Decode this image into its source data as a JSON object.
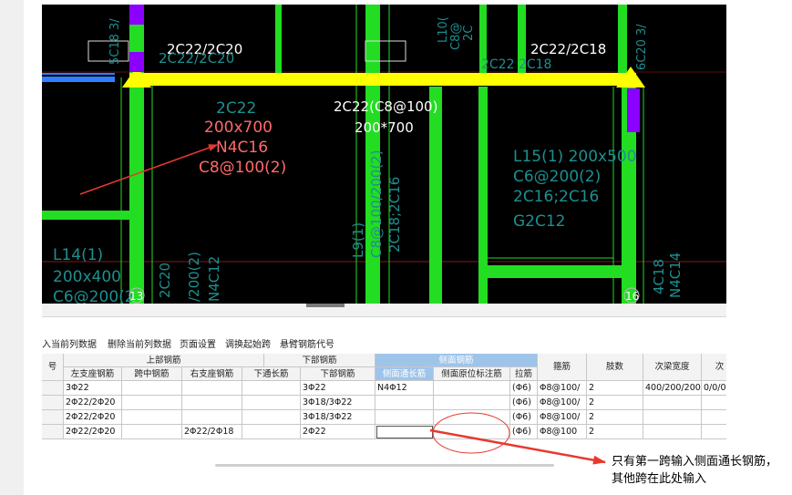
{
  "cad": {
    "label_top_left": "2C22/2C20",
    "label_top_right": "2C22/2C18",
    "ghost_top_left": "2C22/2C20",
    "ghost_top_right": "2C22 2C18",
    "vert_top_1": "5C18 3/",
    "vert_top_2": "L10(",
    "vert_top_3": "C8@",
    "vert_top_4": "2C",
    "vert_top_5": "6C20 3/",
    "beam_name": "2C22(C8@100)",
    "beam_size": "200*700",
    "left_label": "2C22",
    "red_size": "200x700",
    "red_side": "N4C16",
    "red_stirrup": "C8@100(2)",
    "l15_1": "L15(1) 200x500",
    "l15_2": "C6@200(2)",
    "l15_3": "2C16;2C16",
    "l15_4": "G2C12",
    "l14_1": "L14(1)",
    "l14_2": "200x400",
    "l14_3": "C6@200(2",
    "l9_1": "L9(1)",
    "l9_2": "C8@100/200(2)",
    "l9_3": "2C18;2C16",
    "l9_4": "200x400",
    "v_bot_1": "2C20",
    "v_bot_2": "/200(2)",
    "v_bot_3": "N4C12",
    "v_bot_4": "4C18",
    "v_bot_5": "N4C14",
    "col_num_left": "13",
    "col_num_right": "16"
  },
  "toolbar": {
    "insert": "入当前列数据",
    "delete": "删除当前列数据",
    "page_setup": "页面设置",
    "swap_start": "调换起始跨",
    "cantilever": "悬臂钢筋代号"
  },
  "grid": {
    "headers": {
      "num": "号",
      "top": "上部钢筋",
      "bottom": "下部钢筋",
      "side": "侧面钢筋",
      "left_support": "左支座钢筋",
      "mid_span": "跨中钢筋",
      "right_support": "右支座钢筋",
      "bottom_through": "下通长筋",
      "bottom_bar": "下部钢筋",
      "side_through": "侧面通长筋",
      "side_original": "侧面原位标注筋",
      "tie": "拉筋",
      "stirrup": "箍筋",
      "legs": "肢数",
      "sub_width": "次梁宽度",
      "sub_extra": "次"
    },
    "rows": [
      {
        "left": "3Φ22",
        "mid": "",
        "right": "",
        "bthru": "",
        "bottom": "3Φ22",
        "side": "N4Φ12",
        "orig": "",
        "tie": "(Φ6)",
        "stirrup": "Φ8@100/",
        "legs": "2",
        "subw": "400/200/200",
        "extra": "0/0/0"
      },
      {
        "left": "2Φ22/2Φ20",
        "mid": "",
        "right": "",
        "bthru": "",
        "bottom": "3Φ18/3Φ22",
        "side": "",
        "orig": "",
        "tie": "(Φ6)",
        "stirrup": "Φ8@100/",
        "legs": "2",
        "subw": "",
        "extra": ""
      },
      {
        "left": "2Φ22/2Φ20",
        "mid": "",
        "right": "",
        "bthru": "",
        "bottom": "3Φ18/3Φ22",
        "side": "",
        "orig": "",
        "tie": "(Φ6)",
        "stirrup": "Φ8@100/",
        "legs": "2",
        "subw": "",
        "extra": ""
      },
      {
        "left": "2Φ22/2Φ20",
        "mid": "",
        "right": "2Φ22/2Φ18",
        "bthru": "",
        "bottom": "2Φ22",
        "side": "",
        "orig": "",
        "tie": "(Φ6)",
        "stirrup": "Φ8@100",
        "legs": "2",
        "subw": "",
        "extra": ""
      }
    ]
  },
  "annotation": {
    "note": "只有第一跨输入侧面通长钢筋，其他跨在此处输入"
  },
  "colors": {
    "cad_bg": "#000000",
    "beam_green": "#22dd22",
    "beam_yellow": "#ffff00",
    "column_purple": "#8b00ff",
    "text_cyan": "#1e8f8f",
    "text_red": "#ff6a6a",
    "arrow_red": "#e8392f",
    "header_blue": "#9fc4ea"
  }
}
